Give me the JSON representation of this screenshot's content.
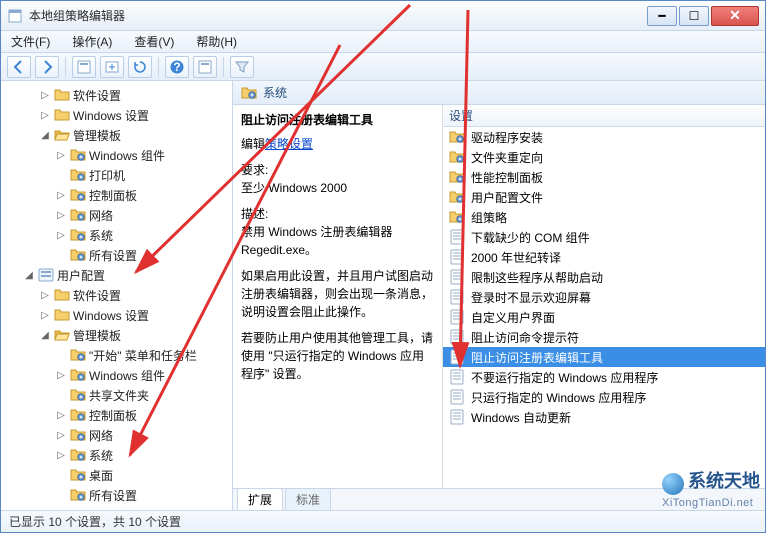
{
  "window": {
    "title": "本地组策略编辑器"
  },
  "menu": {
    "file": "文件(F)",
    "action": "操作(A)",
    "view": "查看(V)",
    "help": "帮助(H)"
  },
  "tree": {
    "items": [
      {
        "depth": 2,
        "twist": "▷",
        "icon": "folder",
        "label": "软件设置"
      },
      {
        "depth": 2,
        "twist": "▷",
        "icon": "folder",
        "label": "Windows 设置"
      },
      {
        "depth": 2,
        "twist": "◢",
        "icon": "folder-open",
        "label": "管理模板"
      },
      {
        "depth": 3,
        "twist": "▷",
        "icon": "folder-gear",
        "label": "Windows 组件"
      },
      {
        "depth": 3,
        "twist": "",
        "icon": "folder-gear",
        "label": "打印机"
      },
      {
        "depth": 3,
        "twist": "▷",
        "icon": "folder-gear",
        "label": "控制面板"
      },
      {
        "depth": 3,
        "twist": "▷",
        "icon": "folder-gear",
        "label": "网络"
      },
      {
        "depth": 3,
        "twist": "▷",
        "icon": "folder-gear",
        "label": "系统"
      },
      {
        "depth": 3,
        "twist": "",
        "icon": "folder-gear",
        "label": "所有设置"
      },
      {
        "depth": 1,
        "twist": "◢",
        "icon": "node",
        "label": "用户配置"
      },
      {
        "depth": 2,
        "twist": "▷",
        "icon": "folder",
        "label": "软件设置"
      },
      {
        "depth": 2,
        "twist": "▷",
        "icon": "folder",
        "label": "Windows 设置"
      },
      {
        "depth": 2,
        "twist": "◢",
        "icon": "folder-open",
        "label": "管理模板"
      },
      {
        "depth": 3,
        "twist": "",
        "icon": "folder-gear",
        "label": "\"开始\" 菜单和任务栏"
      },
      {
        "depth": 3,
        "twist": "▷",
        "icon": "folder-gear",
        "label": "Windows 组件"
      },
      {
        "depth": 3,
        "twist": "",
        "icon": "folder-gear",
        "label": "共享文件夹"
      },
      {
        "depth": 3,
        "twist": "▷",
        "icon": "folder-gear",
        "label": "控制面板"
      },
      {
        "depth": 3,
        "twist": "▷",
        "icon": "folder-gear",
        "label": "网络"
      },
      {
        "depth": 3,
        "twist": "▷",
        "icon": "folder-gear",
        "label": "系统"
      },
      {
        "depth": 3,
        "twist": "",
        "icon": "folder-gear",
        "label": "桌面"
      },
      {
        "depth": 3,
        "twist": "",
        "icon": "folder-gear",
        "label": "所有设置"
      }
    ]
  },
  "pathbar": {
    "icon": "folder-gear",
    "label": "系统"
  },
  "detail": {
    "title": "阻止访问注册表编辑工具",
    "edit_prefix": "编辑",
    "edit_link": "策略设置",
    "req_label": "要求:",
    "req_value": "至少 Windows 2000",
    "desc_label": "描述:",
    "desc_l1": "禁用 Windows 注册表编辑器",
    "desc_l2": "Regedit.exe。",
    "para2": "如果启用此设置，并且用户试图启动注册表编辑器，则会出现一条消息，说明设置会阻止此操作。",
    "para3": "若要防止用户使用其他管理工具，请使用 \"只运行指定的 Windows 应用程序\" 设置。"
  },
  "listhdr": {
    "col1": "设置"
  },
  "settings": [
    {
      "label": "驱动程序安装",
      "icon": "folder-gear"
    },
    {
      "label": "文件夹重定向",
      "icon": "folder-gear"
    },
    {
      "label": "性能控制面板",
      "icon": "folder-gear"
    },
    {
      "label": "用户配置文件",
      "icon": "folder-gear"
    },
    {
      "label": "组策略",
      "icon": "folder-gear"
    },
    {
      "label": "下载缺少的 COM 组件",
      "icon": "policy"
    },
    {
      "label": "2000 年世纪转译",
      "icon": "policy"
    },
    {
      "label": "限制这些程序从帮助启动",
      "icon": "policy"
    },
    {
      "label": "登录时不显示欢迎屏幕",
      "icon": "policy"
    },
    {
      "label": "自定义用户界面",
      "icon": "policy"
    },
    {
      "label": "阻止访问命令提示符",
      "icon": "policy"
    },
    {
      "label": "阻止访问注册表编辑工具",
      "icon": "policy",
      "selected": true
    },
    {
      "label": "不要运行指定的 Windows 应用程序",
      "icon": "policy"
    },
    {
      "label": "只运行指定的 Windows 应用程序",
      "icon": "policy"
    },
    {
      "label": "Windows 自动更新",
      "icon": "policy"
    }
  ],
  "tabs": {
    "extended": "扩展",
    "standard": "标准"
  },
  "status": {
    "text": "已显示 10 个设置，共 10 个设置"
  },
  "watermark": {
    "line1": "系统天地",
    "line2": "XiTongTianDi.net"
  },
  "colors": {
    "selection": "#3a8ee6",
    "link": "#0645cc",
    "annotation": "#e03030"
  }
}
